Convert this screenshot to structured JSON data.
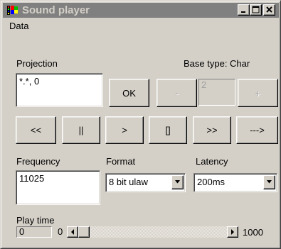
{
  "window": {
    "title": "Sound player",
    "minimize_label": "_",
    "maximize_label": "□",
    "close_label": "X"
  },
  "menu": {
    "items": [
      {
        "label": "Data"
      }
    ]
  },
  "projection": {
    "label": "Projection",
    "value": "*.*, 0",
    "ok_label": "OK"
  },
  "base_type": {
    "label": "Base type: Char",
    "minus_label": "-",
    "value": "2",
    "plus_label": "+"
  },
  "transport": {
    "buttons": [
      {
        "label": "<<",
        "name": "rewind-button"
      },
      {
        "label": "||",
        "name": "pause-button"
      },
      {
        "label": ">",
        "name": "play-button"
      },
      {
        "label": "[]",
        "name": "stop-button"
      },
      {
        "label": ">>",
        "name": "fast-forward-button"
      },
      {
        "label": "--->",
        "name": "next-button"
      }
    ]
  },
  "frequency": {
    "label": "Frequency",
    "value": "11025"
  },
  "format": {
    "label": "Format",
    "selected": "8 bit ulaw"
  },
  "latency": {
    "label": "Latency",
    "selected": "200ms"
  },
  "play_time": {
    "label": "Play time",
    "current_value": "0",
    "min_label": "0",
    "max_label": "1000",
    "position_fraction": 0
  }
}
